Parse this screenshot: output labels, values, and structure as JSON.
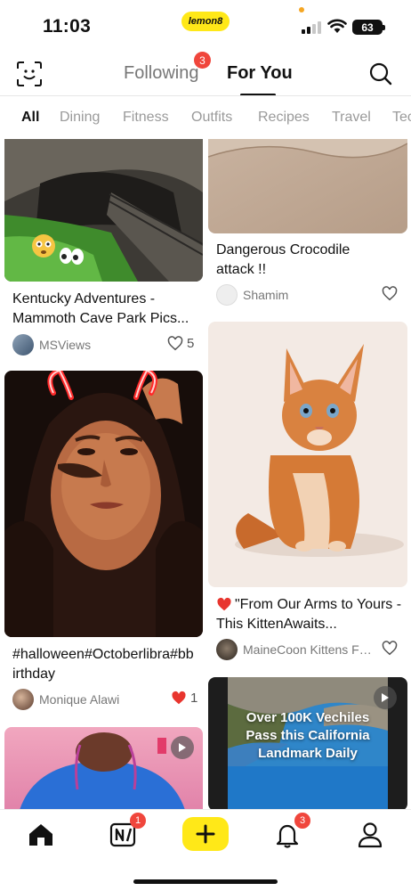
{
  "status": {
    "time": "11:03",
    "brand": "lemon8",
    "battery": "63"
  },
  "header": {
    "tabs": [
      {
        "label": "Following",
        "badge": "3"
      },
      {
        "label": "For You"
      }
    ]
  },
  "categories": [
    "All",
    "Dining",
    "Fitness",
    "Outfits",
    "Recipes",
    "Travel",
    "Tec"
  ],
  "feed": {
    "left": [
      {
        "title": "Kentucky Adventures - Mammoth Cave Park Pics...",
        "author": "MSViews",
        "likes": "5",
        "liked": false
      },
      {
        "title": "#halloween#Octoberlibra#bbirthday",
        "author": "Monique Alawi",
        "likes": "1",
        "liked": true
      },
      {
        "title": "",
        "author": "",
        "likes": "",
        "liked": false
      }
    ],
    "right": [
      {
        "title": "Dangerous Crocodile attack !!",
        "author": "Shamim",
        "likes": "",
        "liked": false
      },
      {
        "title": "\"From Our Arms to Yours - This KittenAwaits...",
        "author": "MaineCoon Kittens For...",
        "likes": "",
        "liked": false
      },
      {
        "overlay_text": "Over 100K Vechiles Pass this California Landmark Daily"
      }
    ]
  },
  "bottom_nav": {
    "items": [
      "home",
      "notes",
      "create",
      "notifications",
      "profile"
    ],
    "notes_badge": "1",
    "notifications_badge": "3"
  },
  "colors": {
    "accent_yellow": "#FFE818",
    "badge_red": "#F0463C",
    "like_red": "#E8352E"
  }
}
